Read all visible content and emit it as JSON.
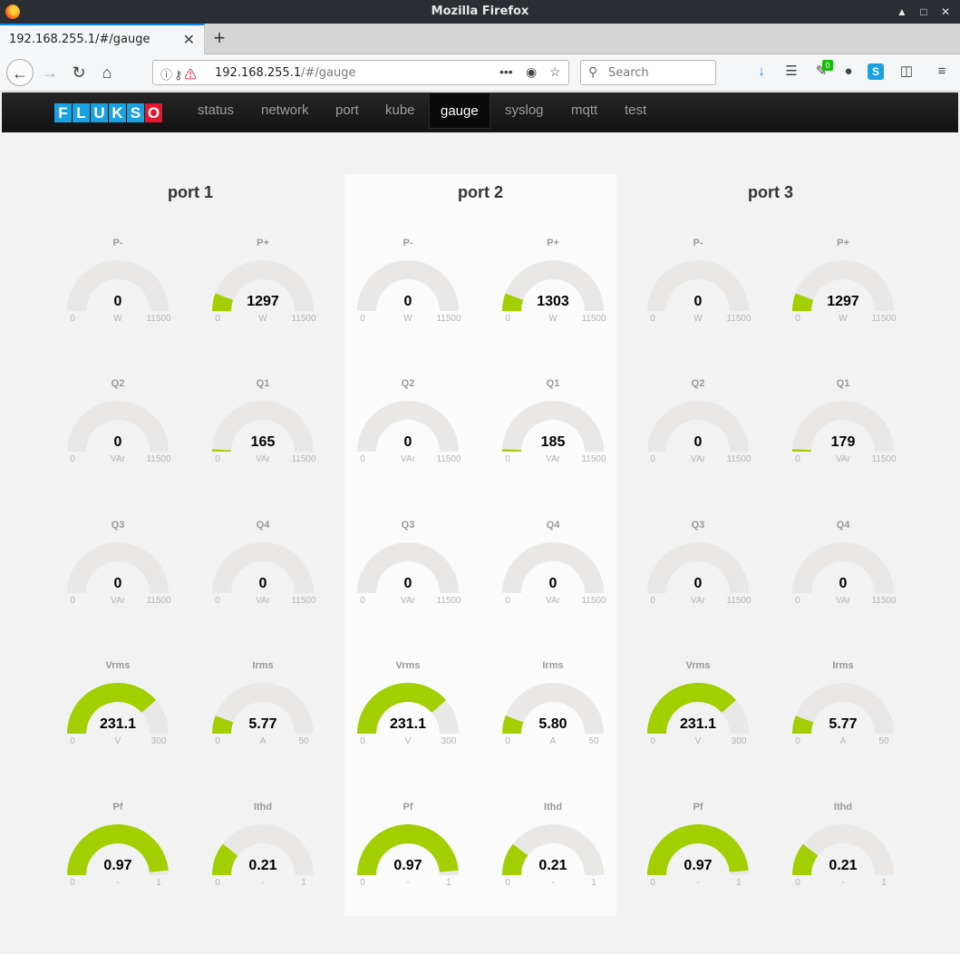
{
  "window": {
    "title": "Mozilla Firefox"
  },
  "tab": {
    "label": "192.168.255.1/#/gauge"
  },
  "url": {
    "host": "192.168.255.1",
    "path": "/#/gauge"
  },
  "search": {
    "placeholder": "Search"
  },
  "toolbar": {
    "badge_count": "0"
  },
  "brand": {
    "letters": [
      "F",
      "L",
      "U",
      "K",
      "S",
      "O"
    ]
  },
  "nav": {
    "items": [
      {
        "label": "status"
      },
      {
        "label": "network"
      },
      {
        "label": "port"
      },
      {
        "label": "kube"
      },
      {
        "label": "gauge",
        "active": true
      },
      {
        "label": "syslog"
      },
      {
        "label": "mqtt"
      },
      {
        "label": "test"
      }
    ]
  },
  "colors": {
    "fill": "#a3cf00",
    "track": "#e9e8e7",
    "nav_bg": "#161616",
    "brand_blue": "#1aa1e1",
    "brand_red": "#e3182d"
  },
  "ports": [
    {
      "title": "port 1",
      "gauges": [
        {
          "label": "P-",
          "value": "0",
          "unit": "W",
          "min": "0",
          "max": "11500",
          "fraction": 0
        },
        {
          "label": "P+",
          "value": "1297",
          "unit": "W",
          "min": "0",
          "max": "11500",
          "fraction": 0.113
        },
        {
          "label": "Q2",
          "value": "0",
          "unit": "VAr",
          "min": "0",
          "max": "11500",
          "fraction": 0
        },
        {
          "label": "Q1",
          "value": "165",
          "unit": "VAr",
          "min": "0",
          "max": "11500",
          "fraction": 0.014
        },
        {
          "label": "Q3",
          "value": "0",
          "unit": "VAr",
          "min": "0",
          "max": "11500",
          "fraction": 0
        },
        {
          "label": "Q4",
          "value": "0",
          "unit": "VAr",
          "min": "0",
          "max": "11500",
          "fraction": 0
        },
        {
          "label": "Vrms",
          "value": "231.1",
          "unit": "V",
          "min": "0",
          "max": "300",
          "fraction": 0.77
        },
        {
          "label": "Irms",
          "value": "5.77",
          "unit": "A",
          "min": "0",
          "max": "50",
          "fraction": 0.115
        },
        {
          "label": "Pf",
          "value": "0.97",
          "unit": "-",
          "min": "0",
          "max": "1",
          "fraction": 0.97
        },
        {
          "label": "Ithd",
          "value": "0.21",
          "unit": "-",
          "min": "0",
          "max": "1",
          "fraction": 0.21
        }
      ]
    },
    {
      "title": "port 2",
      "gauges": [
        {
          "label": "P-",
          "value": "0",
          "unit": "W",
          "min": "0",
          "max": "11500",
          "fraction": 0
        },
        {
          "label": "P+",
          "value": "1303",
          "unit": "W",
          "min": "0",
          "max": "11500",
          "fraction": 0.113
        },
        {
          "label": "Q2",
          "value": "0",
          "unit": "VAr",
          "min": "0",
          "max": "11500",
          "fraction": 0
        },
        {
          "label": "Q1",
          "value": "185",
          "unit": "VAr",
          "min": "0",
          "max": "11500",
          "fraction": 0.016
        },
        {
          "label": "Q3",
          "value": "0",
          "unit": "VAr",
          "min": "0",
          "max": "11500",
          "fraction": 0
        },
        {
          "label": "Q4",
          "value": "0",
          "unit": "VAr",
          "min": "0",
          "max": "11500",
          "fraction": 0
        },
        {
          "label": "Vrms",
          "value": "231.1",
          "unit": "V",
          "min": "0",
          "max": "300",
          "fraction": 0.77
        },
        {
          "label": "Irms",
          "value": "5.80",
          "unit": "A",
          "min": "0",
          "max": "50",
          "fraction": 0.116
        },
        {
          "label": "Pf",
          "value": "0.97",
          "unit": "-",
          "min": "0",
          "max": "1",
          "fraction": 0.97
        },
        {
          "label": "Ithd",
          "value": "0.21",
          "unit": "-",
          "min": "0",
          "max": "1",
          "fraction": 0.21
        }
      ]
    },
    {
      "title": "port 3",
      "gauges": [
        {
          "label": "P-",
          "value": "0",
          "unit": "W",
          "min": "0",
          "max": "11500",
          "fraction": 0
        },
        {
          "label": "P+",
          "value": "1297",
          "unit": "W",
          "min": "0",
          "max": "11500",
          "fraction": 0.113
        },
        {
          "label": "Q2",
          "value": "0",
          "unit": "VAr",
          "min": "0",
          "max": "11500",
          "fraction": 0
        },
        {
          "label": "Q1",
          "value": "179",
          "unit": "VAr",
          "min": "0",
          "max": "11500",
          "fraction": 0.016
        },
        {
          "label": "Q3",
          "value": "0",
          "unit": "VAr",
          "min": "0",
          "max": "11500",
          "fraction": 0
        },
        {
          "label": "Q4",
          "value": "0",
          "unit": "VAr",
          "min": "0",
          "max": "11500",
          "fraction": 0
        },
        {
          "label": "Vrms",
          "value": "231.1",
          "unit": "V",
          "min": "0",
          "max": "300",
          "fraction": 0.77
        },
        {
          "label": "Irms",
          "value": "5.77",
          "unit": "A",
          "min": "0",
          "max": "50",
          "fraction": 0.115
        },
        {
          "label": "Pf",
          "value": "0.97",
          "unit": "-",
          "min": "0",
          "max": "1",
          "fraction": 0.97
        },
        {
          "label": "Ithd",
          "value": "0.21",
          "unit": "-",
          "min": "0",
          "max": "1",
          "fraction": 0.21
        }
      ]
    }
  ]
}
